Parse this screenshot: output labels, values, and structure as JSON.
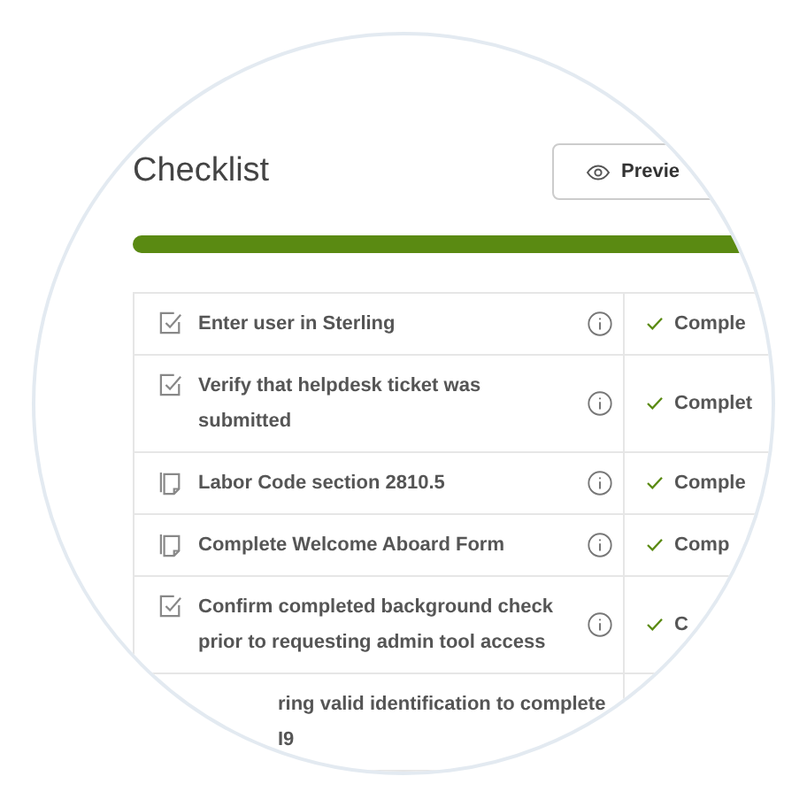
{
  "title": "Checklist",
  "preview_button": {
    "label": "Previe"
  },
  "progress": {
    "level": 0.95
  },
  "rows": [
    {
      "kind": "task",
      "name": "Enter user in Sterling",
      "status": "Comple",
      "complete": true
    },
    {
      "kind": "task",
      "name": "Verify that helpdesk ticket was submitted",
      "status": "Complet",
      "complete": true
    },
    {
      "kind": "document",
      "name": "Labor Code section 2810.5",
      "status": "Comple",
      "complete": true
    },
    {
      "kind": "document",
      "name": "Complete Welcome Aboard Form",
      "status": "Comp",
      "complete": true
    },
    {
      "kind": "task",
      "name": "Confirm completed background check prior to requesting admin tool access",
      "status": "C",
      "complete": true
    },
    {
      "kind": "hidden",
      "name": "ring valid identification to complete I9"
    }
  ]
}
